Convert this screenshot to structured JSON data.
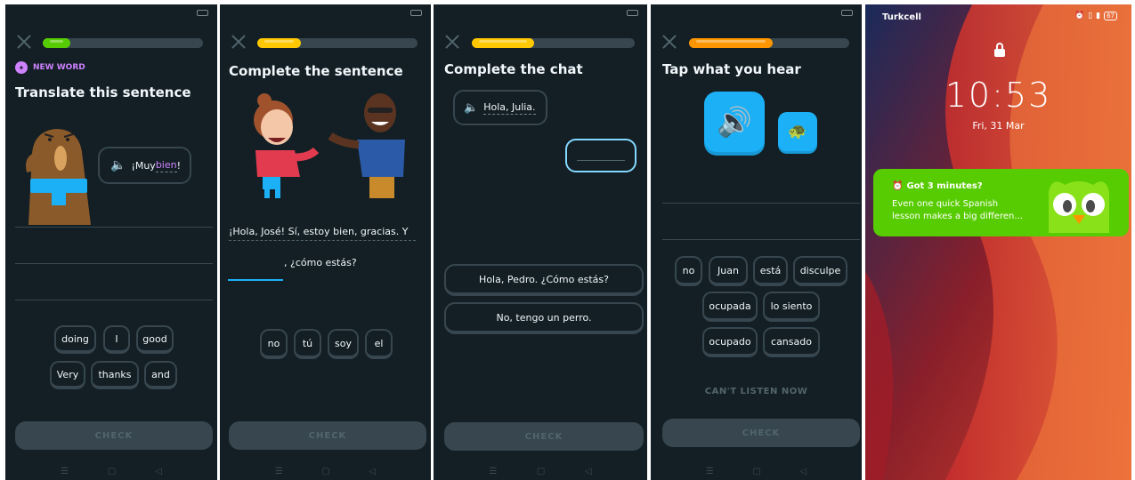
{
  "colors": {
    "background": "#131f24",
    "accent_green": "#58cc02",
    "accent_yellow": "#ffc800",
    "accent_orange": "#ff9600",
    "accent_blue": "#1cb0f6",
    "purple": "#ce82ff",
    "border": "#37464f"
  },
  "screen1": {
    "progress": 0.17,
    "badge": "NEW WORD",
    "title": "Translate this sentence",
    "bubble_pre": "¡Muy ",
    "bubble_word": "bien",
    "bubble_post": "!",
    "words": [
      "doing",
      "I",
      "good",
      "Very",
      "thanks",
      "and"
    ],
    "check": "CHECK"
  },
  "screen2": {
    "progress": 0.27,
    "title": "Complete the sentence",
    "line1": "¡Hola, José! Sí, estoy bien, gracias. Y",
    "line2": ", ¿cómo estás?",
    "words": [
      "no",
      "tú",
      "soy",
      "el"
    ],
    "check": "CHECK"
  },
  "screen3": {
    "progress": 0.38,
    "title": "Complete the chat",
    "bubble": "Hola, Julia.",
    "options": [
      "Hola, Pedro. ¿Cómo estás?",
      "No, tengo un perro."
    ],
    "check": "CHECK"
  },
  "screen4": {
    "progress": 0.52,
    "title": "Tap what you hear",
    "words_row1": [
      "no",
      "Juan",
      "está",
      "disculpe"
    ],
    "words_row2": [
      "ocupada",
      "lo siento"
    ],
    "words_row3": [
      "ocupado",
      "cansado"
    ],
    "cant_listen": "CAN'T LISTEN NOW",
    "check": "CHECK"
  },
  "lockscreen": {
    "carrier": "Turkcell",
    "time": "10:53",
    "date": "Fri, 31 Mar",
    "battery": "67",
    "notification": {
      "title": "Got 3 minutes?",
      "body_line1": "Even one quick Spanish",
      "body_line2": "lesson makes a big differen..."
    }
  }
}
